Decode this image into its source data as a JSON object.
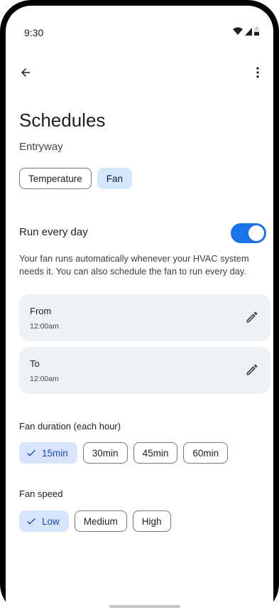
{
  "status_bar": {
    "time": "9:30"
  },
  "header": {
    "title": "Schedules",
    "subtitle": "Entryway"
  },
  "mode_tabs": [
    {
      "label": "Temperature",
      "selected": false
    },
    {
      "label": "Fan",
      "selected": true
    }
  ],
  "run_every_day": {
    "label": "Run every day",
    "enabled": true
  },
  "description": "Your fan runs automatically whenever your HVAC system needs it. You can also schedule the fan to run every day.",
  "from_card": {
    "label": "From",
    "value": "12:00am"
  },
  "to_card": {
    "label": "To",
    "value": "12:00am"
  },
  "fan_duration": {
    "label": "Fan duration (each hour)",
    "options": [
      "15min",
      "30min",
      "45min",
      "60min"
    ],
    "selected": "15min"
  },
  "fan_speed": {
    "label": "Fan speed",
    "options": [
      "Low",
      "Medium",
      "High"
    ],
    "selected": "Low"
  },
  "colors": {
    "accent": "#1a73e8",
    "selected_chip": "#d8e4fb",
    "card_bg": "#eef2f6"
  }
}
